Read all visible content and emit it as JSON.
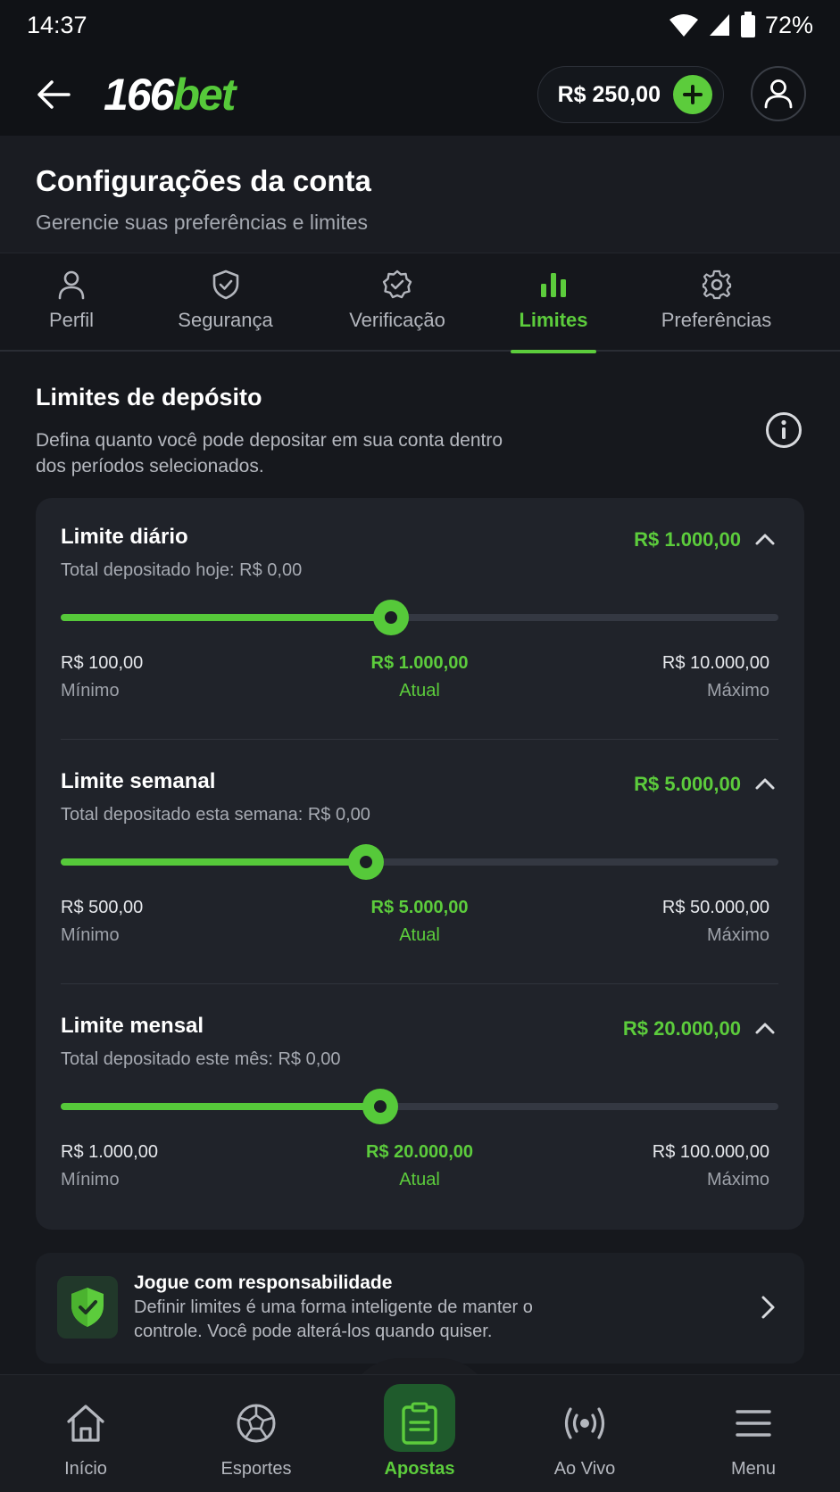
{
  "status_bar": {
    "time": "14:37",
    "battery": "72%"
  },
  "header": {
    "logo_num": "166",
    "logo_brand": "bet",
    "balance": "R$ 250,00"
  },
  "page": {
    "title": "Configurações da conta",
    "subtitle": "Gerencie suas preferências e limites"
  },
  "tabs": [
    {
      "label": "Perfil",
      "icon": "user-icon"
    },
    {
      "label": "Segurança",
      "icon": "shield-icon"
    },
    {
      "label": "Verificação",
      "icon": "badge-check-icon"
    },
    {
      "label": "Limites",
      "icon": "bar-chart-icon",
      "active": true
    },
    {
      "label": "Preferências",
      "icon": "gear-icon"
    }
  ],
  "section": {
    "title": "Limites de depósito",
    "description": "Defina quanto você pode depositar em sua conta dentro dos períodos selecionados."
  },
  "limits": [
    {
      "name": "Limite diário",
      "value": "R$ 1.000,00",
      "sub": "Total depositado hoje: R$ 0,00",
      "min": "R$ 100,00",
      "current": "R$ 1.000,00",
      "max": "R$ 10.000,00",
      "min_label": "Mínimo",
      "current_label": "Atual",
      "max_label": "Máximo",
      "slider_percent": 46
    },
    {
      "name": "Limite semanal",
      "value": "R$ 5.000,00",
      "sub": "Total depositado esta semana: R$ 0,00",
      "min": "R$ 500,00",
      "current": "R$ 5.000,00",
      "max": "R$ 50.000,00",
      "min_label": "Mínimo",
      "current_label": "Atual",
      "max_label": "Máximo",
      "slider_percent": 42.5
    },
    {
      "name": "Limite mensal",
      "value": "R$ 20.000,00",
      "sub": "Total depositado este mês: R$ 0,00",
      "min": "R$ 1.000,00",
      "current": "R$ 20.000,00",
      "max": "R$ 100.000,00",
      "min_label": "Mínimo",
      "current_label": "Atual",
      "max_label": "Máximo",
      "slider_percent": 44.5
    }
  ],
  "responsible": {
    "title": "Jogue com responsabilidade",
    "text": "Definir limites é uma forma inteligente de manter o controle. Você pode alterá-los quando quiser."
  },
  "bottom_nav": [
    {
      "label": "Início",
      "icon": "home-icon"
    },
    {
      "label": "Esportes",
      "icon": "soccer-ball-icon"
    },
    {
      "label": "Apostas",
      "icon": "bet-slip-icon",
      "active": true
    },
    {
      "label": "Ao Vivo",
      "icon": "live-broadcast-icon"
    },
    {
      "label": "Menu",
      "icon": "menu-icon"
    }
  ],
  "colors": {
    "accent": "#5ccc3c",
    "background": "#101216",
    "card": "#20232a"
  }
}
